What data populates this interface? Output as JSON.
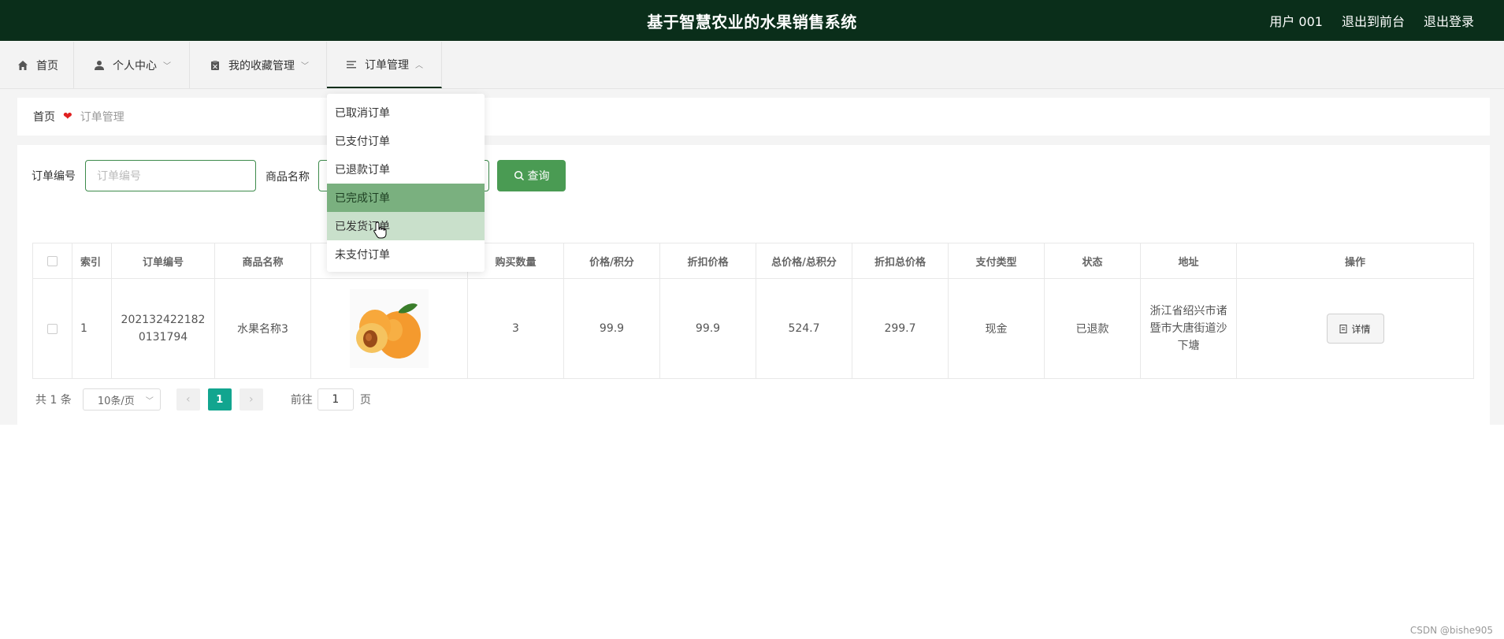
{
  "header": {
    "title": "基于智慧农业的水果销售系统",
    "user": "用户 001",
    "back_front": "退出到前台",
    "logout": "退出登录"
  },
  "nav": {
    "home": "首页",
    "personal": "个人中心",
    "favorites": "我的收藏管理",
    "orders": "订单管理"
  },
  "breadcrumb": {
    "home": "首页",
    "current": "订单管理"
  },
  "search": {
    "order_no_label": "订单编号",
    "order_no_placeholder": "订单编号",
    "product_label": "商品名称",
    "query_button": "查询"
  },
  "table": {
    "columns": [
      "索引",
      "订单编号",
      "商品名称",
      "",
      "购买数量",
      "价格/积分",
      "折扣价格",
      "总价格/总积分",
      "折扣总价格",
      "支付类型",
      "状态",
      "地址",
      "操作"
    ],
    "rows": [
      {
        "index": "1",
        "order_no": "2021324221820131794",
        "product": "水果名称3",
        "qty": "3",
        "price": "99.9",
        "discount": "99.9",
        "total": "524.7",
        "discount_total": "299.7",
        "pay_type": "现金",
        "status": "已退款",
        "address": "浙江省绍兴市诸暨市大唐街道沙下塘",
        "action": "详情"
      }
    ]
  },
  "pagination": {
    "total": "共 1 条",
    "page_size": "10条/页",
    "current_page": "1",
    "goto_label": "前往",
    "goto_value": "1",
    "page_suffix": "页"
  },
  "dropdown": {
    "items": [
      "已取消订单",
      "已支付订单",
      "已退款订单",
      "已完成订单",
      "已发货订单",
      "未支付订单"
    ]
  },
  "watermark": "CSDN @bishe905",
  "colors": {
    "header_bg": "#0a2e1a",
    "accent_green": "#4a9b53",
    "page_active": "#12a58f"
  }
}
